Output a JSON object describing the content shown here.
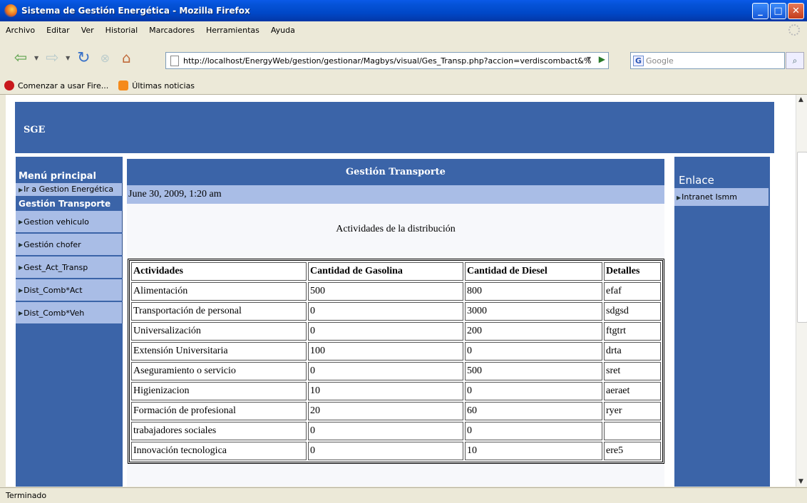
{
  "window": {
    "title": "Sistema de Gestión Energética - Mozilla Firefox"
  },
  "menubar": [
    "Archivo",
    "Editar",
    "Ver",
    "Historial",
    "Marcadores",
    "Herramientas",
    "Ayuda"
  ],
  "navbar": {
    "url": "http://localhost/EnergyWeb/gestion/gestionar/Magbys/visual/Ges_Transp.php?accion=verdiscombact&%",
    "search_placeholder": "Google",
    "search_engine": "G"
  },
  "bookmarks": [
    "Comenzar a usar Fire...",
    "Últimas noticias"
  ],
  "page": {
    "brand": "SGE",
    "left_menu": {
      "heading": "Menú principal",
      "top_link": "Ir a Gestion Energética",
      "section": "Gestión Transporte",
      "items": [
        "Gestion vehiculo",
        "Gestión chofer",
        "Gest_Act_Transp",
        "Dist_Comb*Act",
        "Dist_Comb*Veh"
      ]
    },
    "main": {
      "banner": "Gestión Transporte",
      "date": "June 30, 2009, 1:20 am",
      "subtitle": "Actividades de la distribución",
      "table": {
        "headers": [
          "Actividades",
          "Cantidad de Gasolina",
          "Cantidad de Diesel",
          "Detalles"
        ],
        "rows": [
          [
            "Alimentación",
            "500",
            "800",
            "efaf"
          ],
          [
            "Transportación de personal",
            "0",
            "3000",
            "sdgsd"
          ],
          [
            "Universalización",
            "0",
            "200",
            "ftgtrt"
          ],
          [
            "Extensión Universitaria",
            "100",
            "0",
            "drta"
          ],
          [
            "Aseguramiento o servicio",
            "0",
            "500",
            "sret"
          ],
          [
            "Higienizacion",
            "10",
            "0",
            "aeraet"
          ],
          [
            "Formación de profesional",
            "20",
            "60",
            "ryer"
          ],
          [
            "trabajadores sociales",
            "0",
            "0",
            ""
          ],
          [
            "Innovación tecnologica",
            "0",
            "10",
            "ere5"
          ]
        ]
      }
    },
    "right_menu": {
      "heading": "Enlace",
      "items": [
        "Intranet Ismm"
      ]
    }
  },
  "status": "Terminado"
}
